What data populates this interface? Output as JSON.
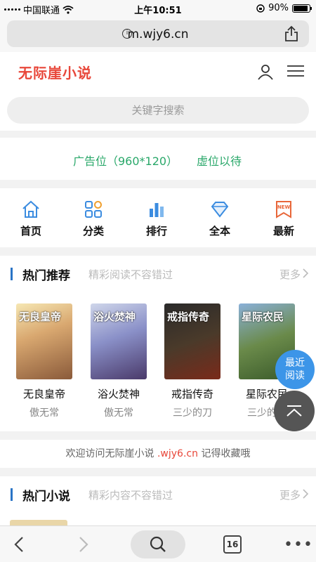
{
  "status": {
    "carrier": "中国联通",
    "time": "上午10:51",
    "battery": "90%",
    "battery_level": 0.9
  },
  "browser": {
    "url": "m.wjy6.cn",
    "tab_count": "16"
  },
  "site": {
    "logo": "无际崖小说",
    "search_placeholder": "关键字搜索"
  },
  "ad": {
    "left": "广告位（960*120）",
    "right": "虚位以待"
  },
  "nav": [
    {
      "label": "首页",
      "icon": "home-icon",
      "color": "#3b8ce0"
    },
    {
      "label": "分类",
      "icon": "category-icon",
      "color": "#3b8ce0"
    },
    {
      "label": "排行",
      "icon": "rank-icon",
      "color": "#3b8ce0"
    },
    {
      "label": "全本",
      "icon": "diamond-icon",
      "color": "#3b8ce0"
    },
    {
      "label": "最新",
      "icon": "new-icon",
      "color": "#e8673a"
    }
  ],
  "hot_recommend": {
    "title": "热门推荐",
    "subtitle": "精彩阅读不容错过",
    "more": "更多",
    "books": [
      {
        "name": "无良皇帝",
        "author": "傲无常",
        "cover_text": "无良皇帝"
      },
      {
        "name": "浴火焚神",
        "author": "傲无常",
        "cover_text": "浴火焚神"
      },
      {
        "name": "戒指传奇",
        "author": "三少的刀",
        "cover_text": "戒指传奇"
      },
      {
        "name": "星际农民",
        "author": "三少的刀",
        "cover_text": "星际农民"
      }
    ]
  },
  "welcome": {
    "prefix": "欢迎访问无际崖小说",
    "domain": ".wjy6.cn",
    "suffix": "记得收藏哦"
  },
  "hot_novels": {
    "title": "热门小说",
    "subtitle": "精彩内容不容错过",
    "more": "更多"
  },
  "floating": {
    "recent_line1": "最近",
    "recent_line2": "阅读"
  }
}
